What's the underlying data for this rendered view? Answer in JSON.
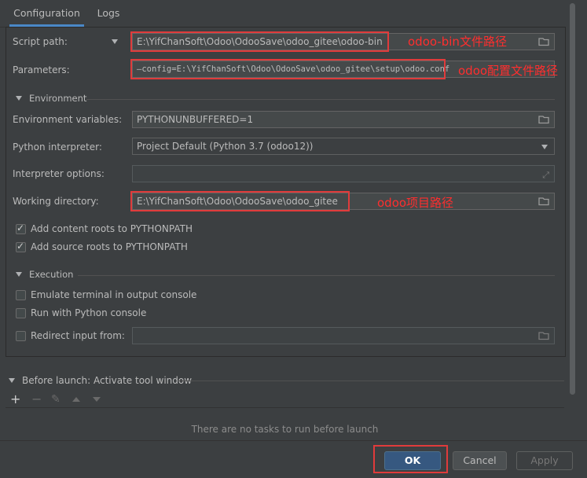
{
  "tabs": [
    {
      "label": "Configuration"
    },
    {
      "label": "Logs"
    }
  ],
  "config": {
    "script_path": {
      "label": "Script path:",
      "value": "E:\\YifChanSoft\\Odoo\\OdooSave\\odoo_gitee\\odoo-bin",
      "annotation": "odoo-bin文件路径"
    },
    "parameters": {
      "label": "Parameters:",
      "value": "—config=E:\\YifChanSoft\\Odoo\\OdooSave\\odoo_gitee\\setup\\odoo.conf",
      "annotation": "odoo配置文件路径"
    },
    "environment_section": "Environment",
    "env_vars": {
      "label": "Environment variables:",
      "value": "PYTHONUNBUFFERED=1"
    },
    "interpreter": {
      "label": "Python interpreter:",
      "value": "Project Default (Python 3.7 (odoo12))"
    },
    "interpreter_options": {
      "label": "Interpreter options:",
      "value": ""
    },
    "working_dir": {
      "label": "Working directory:",
      "value": "E:\\YifChanSoft\\Odoo\\OdooSave\\odoo_gitee",
      "annotation": "odoo项目路径"
    },
    "add_content_roots": {
      "label": "Add content roots to PYTHONPATH",
      "checked": true
    },
    "add_source_roots": {
      "label": "Add source roots to PYTHONPATH",
      "checked": true
    },
    "execution_section": "Execution",
    "emulate_terminal": {
      "label": "Emulate terminal in output console",
      "checked": false
    },
    "run_with_console": {
      "label": "Run with Python console",
      "checked": false
    },
    "redirect_input": {
      "label": "Redirect input from:",
      "checked": false,
      "value": ""
    }
  },
  "before_launch": {
    "title": "Before launch: Activate tool window",
    "empty_text": "There are no tasks to run before launch",
    "toolbar": [
      "add-icon",
      "remove-icon",
      "edit-icon",
      "move-up-icon",
      "move-down-icon"
    ]
  },
  "buttons": {
    "ok": "OK",
    "cancel": "Cancel",
    "apply": "Apply"
  },
  "colors": {
    "accent": "#4a88c7",
    "annotation": "#ff2e2e",
    "primary_button": "#365880"
  }
}
